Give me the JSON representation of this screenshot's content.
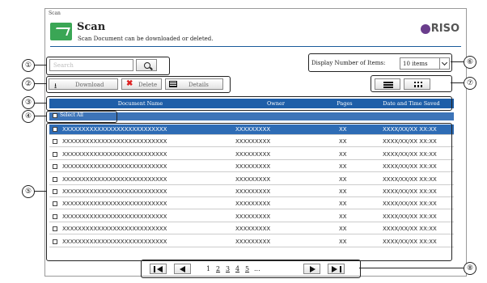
{
  "breadcrumb": "Scan",
  "header": {
    "title": "Scan",
    "subtitle": "Scan Document can be downloaded or deleted.",
    "brand": "RISO"
  },
  "search": {
    "placeholder": "Search"
  },
  "display": {
    "label": "Display Number of Items:",
    "value": "10 items"
  },
  "toolbar": {
    "download": "Download",
    "delete": "Delete",
    "details": "Details"
  },
  "table": {
    "headers": [
      "Document Name",
      "Owner",
      "Pages",
      "Date and Time Saved"
    ],
    "select_all": "Select All",
    "rows": [
      {
        "name": "XXXXXXXXXXXXXXXXXXXXXXXXXXX",
        "owner": "XXXXXXXXX",
        "pages": "XX",
        "date": "XXXX/XX/XX XX:XX",
        "selected": true
      },
      {
        "name": "XXXXXXXXXXXXXXXXXXXXXXXXXXX",
        "owner": "XXXXXXXXX",
        "pages": "XX",
        "date": "XXXX/XX/XX XX:XX",
        "selected": false
      },
      {
        "name": "XXXXXXXXXXXXXXXXXXXXXXXXXXX",
        "owner": "XXXXXXXXX",
        "pages": "XX",
        "date": "XXXX/XX/XX XX:XX",
        "selected": false
      },
      {
        "name": "XXXXXXXXXXXXXXXXXXXXXXXXXXX",
        "owner": "XXXXXXXXX",
        "pages": "XX",
        "date": "XXXX/XX/XX XX:XX",
        "selected": false
      },
      {
        "name": "XXXXXXXXXXXXXXXXXXXXXXXXXXX",
        "owner": "XXXXXXXXX",
        "pages": "XX",
        "date": "XXXX/XX/XX XX:XX",
        "selected": false
      },
      {
        "name": "XXXXXXXXXXXXXXXXXXXXXXXXXXX",
        "owner": "XXXXXXXXX",
        "pages": "XX",
        "date": "XXXX/XX/XX XX:XX",
        "selected": false
      },
      {
        "name": "XXXXXXXXXXXXXXXXXXXXXXXXXXX",
        "owner": "XXXXXXXXX",
        "pages": "XX",
        "date": "XXXX/XX/XX XX:XX",
        "selected": false
      },
      {
        "name": "XXXXXXXXXXXXXXXXXXXXXXXXXXX",
        "owner": "XXXXXXXXX",
        "pages": "XX",
        "date": "XXXX/XX/XX XX:XX",
        "selected": false
      },
      {
        "name": "XXXXXXXXXXXXXXXXXXXXXXXXXXX",
        "owner": "XXXXXXXXX",
        "pages": "XX",
        "date": "XXXX/XX/XX XX:XX",
        "selected": false
      },
      {
        "name": "XXXXXXXXXXXXXXXXXXXXXXXXXXX",
        "owner": "XXXXXXXXX",
        "pages": "XX",
        "date": "XXXX/XX/XX XX:XX",
        "selected": false
      }
    ]
  },
  "pager": {
    "pages": [
      "1",
      "2",
      "3",
      "4",
      "5",
      "..."
    ]
  },
  "callouts": [
    "①",
    "②",
    "③",
    "④",
    "⑤",
    "⑥",
    "⑦",
    "⑧"
  ],
  "icons": {
    "search": "search-icon",
    "download": "download-icon",
    "delete": "delete-x-icon",
    "details": "details-list-icon",
    "list": "list-view-icon",
    "thumbnail": "thumbnail-view-icon",
    "first": "first-page-icon",
    "prev": "prev-page-icon",
    "next": "next-page-icon",
    "last": "last-page-icon"
  },
  "colors": {
    "header_bar": "#1e5ea8",
    "selected_row": "#2e6cb5",
    "scan_icon": "#3aa655",
    "brand": "#6a3d8c"
  }
}
